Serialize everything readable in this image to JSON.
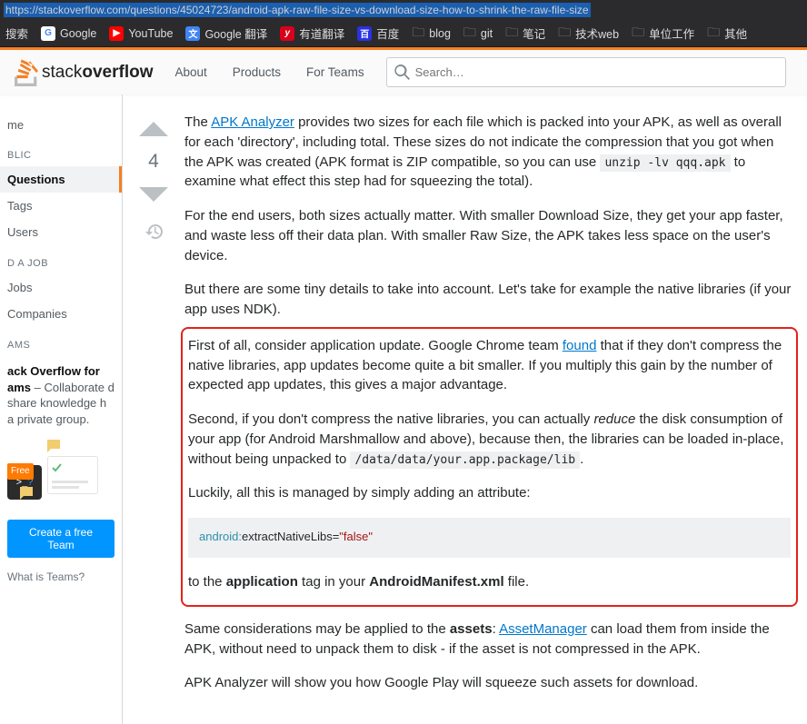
{
  "url": "https://stackoverflow.com/questions/45024723/android-apk-raw-file-size-vs-download-size-how-to-shrink-the-raw-file-size",
  "bookmarks": {
    "search_label": "搜索",
    "google": "Google",
    "youtube": "YouTube",
    "gtranslate": "Google 翻译",
    "youdao": "有道翻译",
    "baidu": "百度",
    "blog": "blog",
    "git": "git",
    "notes": "笔记",
    "techweb": "技术web",
    "work": "单位工作",
    "other": "其他"
  },
  "header": {
    "logo_text": "stack",
    "logo_bold": "overflow",
    "nav": {
      "about": "About",
      "products": "Products",
      "teams": "For Teams"
    },
    "search_placeholder": "Search…"
  },
  "sidebar": {
    "home": "me",
    "public_hdr": "BLIC",
    "questions": "Questions",
    "tags": "Tags",
    "users": "Users",
    "findjob_hdr": "D A JOB",
    "jobs": "Jobs",
    "companies": "Companies",
    "teams_hdr": "AMS",
    "teams_title": "ack Overflow for ams",
    "teams_desc": " – Collaborate d share knowledge h a private group.",
    "free_badge": "Free",
    "create_btn": "Create a free Team",
    "what_link": "What is Teams?"
  },
  "vote": {
    "count": "4"
  },
  "answer": {
    "p1_pre": "The ",
    "p1_link": "APK Analyzer",
    "p1_post": " provides two sizes for each file which is packed into your APK, as well as overall for each 'directory', including total. These sizes do not indicate the compression that you got when the APK was created (APK format is ZIP compatible, so you can use ",
    "p1_code": "unzip -lv qqq.apk",
    "p1_end": " to examine what effect this step had for squeezing the total).",
    "p2": "For the end users, both sizes actually matter. With smaller Download Size, they get your app faster, and waste less off their data plan. With smaller Raw Size, the APK takes less space on the user's device.",
    "p3": "But there are some tiny details to take into account. Let's take for example the native libraries (if your app uses NDK).",
    "p4_pre": "First of all, consider application update. Google Chrome team ",
    "p4_link": "found",
    "p4_post": " that if they don't compress the native libraries, app updates become quite a bit smaller. If you multiply this gain by the number of expected app updates, this gives a major advantage.",
    "p5_pre": "Second, if you don't compress the native libraries, you can actually ",
    "p5_em": "reduce",
    "p5_post": " the disk consumption of your app (for Android Marshmallow and above), because then, the libraries can be loaded in-place, without being unpacked to ",
    "p5_code": "/data/data/your.app.package/lib",
    "p5_end": ".",
    "p6": "Luckily, all this is managed by simply adding an attribute:",
    "code_ns": "android:",
    "code_attr": "extractNativeLibs=",
    "code_val": "\"false\"",
    "p7_pre": "to the ",
    "p7_b1": "application",
    "p7_mid": " tag in your ",
    "p7_b2": "AndroidManifest.xml",
    "p7_end": " file.",
    "p8_pre": "Same considerations may be applied to the ",
    "p8_b": "assets",
    "p8_mid": ": ",
    "p8_link": "AssetManager",
    "p8_post": " can load them from inside the APK, without need to unpack them to disk - if the asset is not compressed in the APK.",
    "p9": "APK Analyzer will show you how Google Play will squeeze such assets for download."
  }
}
